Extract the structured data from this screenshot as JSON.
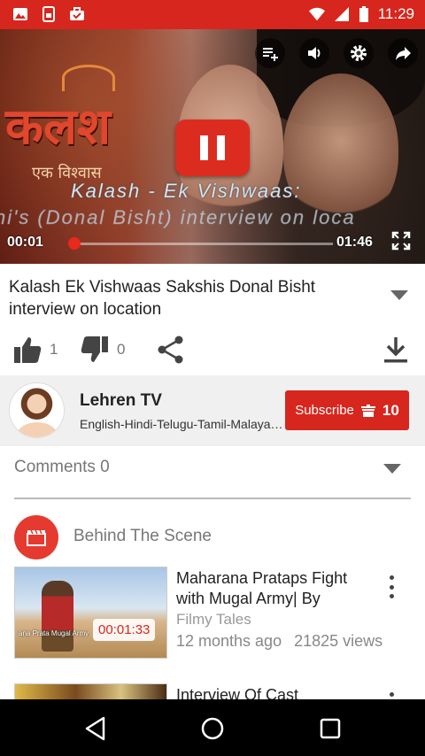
{
  "status_bar": {
    "time": "11:29",
    "left_icons": [
      "gallery-icon",
      "screen-lock-icon",
      "briefcase-icon"
    ],
    "right_icons": [
      "wifi-icon",
      "signal-icon",
      "battery-icon"
    ]
  },
  "player": {
    "logo_text": "कलश",
    "logo_sub": "एक विश्वास",
    "subtitle_line1": "Kalash - Ek Vishwaas:",
    "subtitle_line2": "hi's (Donal Bisht) interview on loca",
    "controls": [
      "add-to-playlist-icon",
      "volume-icon",
      "settings-icon",
      "share-icon"
    ],
    "state": "playing",
    "time_current": "00:01",
    "time_total": "01:46",
    "progress": 0.01
  },
  "video": {
    "title": "Kalash Ek Vishwaas Sakshis Donal Bisht interview on location",
    "likes": "1",
    "dislikes": "0"
  },
  "channel": {
    "name": "Lehren TV",
    "description": "English-Hindi-Telugu-Tamil-Malayalam",
    "subscribe_label": "Subscribe",
    "subscriber_count": "10"
  },
  "comments": {
    "label": "Comments 0"
  },
  "playlist": {
    "title": "Behind The Scene"
  },
  "related": [
    {
      "title": "Maharana Prataps Fight with Mugal Army| By",
      "channel": "Filmy Tales",
      "age": "12 months ago",
      "views": "21825 views",
      "duration": "00:01:33",
      "thumb_caption": "ana Prata Mugal Army"
    },
    {
      "title": "Interview Of Cast",
      "channel": "",
      "age": "",
      "views": "",
      "duration": ""
    }
  ],
  "colors": {
    "accent": "#d7261e",
    "nav_bar": "#000000",
    "channel_row_bg": "#f0f0f0"
  }
}
